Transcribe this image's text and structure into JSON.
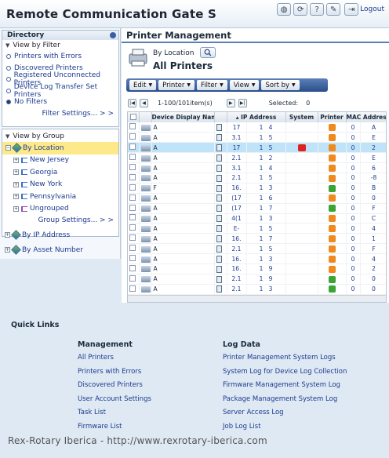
{
  "app": {
    "title": "Remote Communication Gate S",
    "top_icons": [
      "globe-icon",
      "refresh-icon",
      "help-icon",
      "tools-icon"
    ],
    "logout_label": "Logout"
  },
  "sidebar": {
    "directory_title": "Directory",
    "view_by_filter": "View by Filter",
    "filters": [
      {
        "label": "Printers with Errors",
        "selected": false
      },
      {
        "label": "Discovered Printers",
        "selected": false
      },
      {
        "label": "Registered Unconnected Printers",
        "selected": false
      },
      {
        "label": "Device Log Transfer Set Printers",
        "selected": false
      },
      {
        "label": "No Filters",
        "selected": true
      }
    ],
    "filter_settings": "Filter Settings... > >",
    "view_by_group": "View by Group",
    "by_location": "By Location",
    "locations": [
      "New Jersey",
      "Georgia",
      "New York",
      "Pennsylvania",
      "Ungrouped"
    ],
    "group_settings": "Group Settings... > >",
    "by_ip_address": "By IP Address",
    "by_asset_number": "By Asset Number"
  },
  "main": {
    "header": "Printer Management",
    "by_location": "By Location",
    "all_printers": "All Printers",
    "toolbar": [
      "Edit",
      "Printer",
      "Filter",
      "View",
      "Sort by"
    ],
    "paging_text": "1-100/101item(s)",
    "selected_label": "Selected:",
    "selected_count": "0",
    "columns": [
      "Device Display Name",
      "IP Address",
      "System",
      "Printer",
      "MAC Address"
    ],
    "sort_indicator": "▴",
    "rows": [
      {
        "name": "A",
        "ip1": "17",
        "ip2": "1",
        "ip3": "4",
        "printer": "orange",
        "mac1": "0",
        "mac2": "A",
        "sel": false,
        "sys": false
      },
      {
        "name": "A",
        "ip1": "3.1",
        "ip2": "1",
        "ip3": "5",
        "printer": "orange",
        "mac1": "0",
        "mac2": "E",
        "sel": false,
        "sys": false
      },
      {
        "name": "A",
        "ip1": "17",
        "ip2": "1",
        "ip3": "5",
        "printer": "orange",
        "mac1": "0",
        "mac2": "2",
        "sel": true,
        "sys": true
      },
      {
        "name": "A",
        "ip1": "2.1",
        "ip2": "1",
        "ip3": "2",
        "printer": "orange",
        "mac1": "0",
        "mac2": "E",
        "sel": false,
        "sys": false
      },
      {
        "name": "A",
        "ip1": "3.1",
        "ip2": "1",
        "ip3": "4",
        "printer": "orange",
        "mac1": "0",
        "mac2": "6",
        "sel": false,
        "sys": false
      },
      {
        "name": "A",
        "ip1": "2.1",
        "ip2": "1",
        "ip3": "5",
        "printer": "orange",
        "mac1": "0",
        "mac2": "-8",
        "sel": false,
        "sys": false
      },
      {
        "name": "F",
        "ip1": "16.",
        "ip2": "1",
        "ip3": "3",
        "printer": "green",
        "mac1": "0",
        "mac2": "B",
        "sel": false,
        "sys": false
      },
      {
        "name": "A",
        "ip1": "(17",
        "ip2": "1",
        "ip3": "6",
        "printer": "orange",
        "mac1": "0",
        "mac2": "0",
        "sel": false,
        "sys": false
      },
      {
        "name": "A",
        "ip1": "(17",
        "ip2": "1",
        "ip3": "7",
        "printer": "green",
        "mac1": "0",
        "mac2": "F",
        "sel": false,
        "sys": false
      },
      {
        "name": "A",
        "ip1": "4(1",
        "ip2": "1",
        "ip3": "3",
        "printer": "orange",
        "mac1": "0",
        "mac2": "C",
        "sel": false,
        "sys": false
      },
      {
        "name": "A",
        "ip1": "E-",
        "ip2": "1",
        "ip3": "5",
        "printer": "orange",
        "mac1": "0",
        "mac2": "4",
        "sel": false,
        "sys": false
      },
      {
        "name": "A",
        "ip1": "16.",
        "ip2": "1",
        "ip3": "7",
        "printer": "orange",
        "mac1": "0",
        "mac2": "1",
        "sel": false,
        "sys": false
      },
      {
        "name": "A",
        "ip1": "2.1",
        "ip2": "1",
        "ip3": "5",
        "printer": "orange",
        "mac1": "0",
        "mac2": "F",
        "sel": false,
        "sys": false
      },
      {
        "name": "A",
        "ip1": "16.",
        "ip2": "1",
        "ip3": "3",
        "printer": "orange",
        "mac1": "0",
        "mac2": "4",
        "sel": false,
        "sys": false
      },
      {
        "name": "A",
        "ip1": "16.",
        "ip2": "1",
        "ip3": "9",
        "printer": "orange",
        "mac1": "0",
        "mac2": "2",
        "sel": false,
        "sys": false
      },
      {
        "name": "A",
        "ip1": "2.1",
        "ip2": "1",
        "ip3": "9",
        "printer": "green",
        "mac1": "0",
        "mac2": "0",
        "sel": false,
        "sys": false
      },
      {
        "name": "A",
        "ip1": "2.1",
        "ip2": "1",
        "ip3": "3",
        "printer": "green",
        "mac1": "0",
        "mac2": "0",
        "sel": false,
        "sys": false
      }
    ]
  },
  "quick_links": {
    "title": "Quick Links",
    "management_head": "Management",
    "management": [
      "All Printers",
      "Printers with Errors",
      "Discovered Printers",
      "User Account Settings",
      "Task List",
      "Firmware List"
    ],
    "logdata_head": "Log Data",
    "logdata": [
      "Printer Management System Logs",
      "System Log for Device Log Collection",
      "Firmware Management System Log",
      "Package Management System Log",
      "Server Access Log",
      "Job Log List"
    ]
  },
  "watermark": "Rex-Rotary Iberica - http://www.rexrotary-iberica.com",
  "colors": {
    "orange": "#f08a1e",
    "green": "#3aa535",
    "accent": "#284f8c"
  }
}
